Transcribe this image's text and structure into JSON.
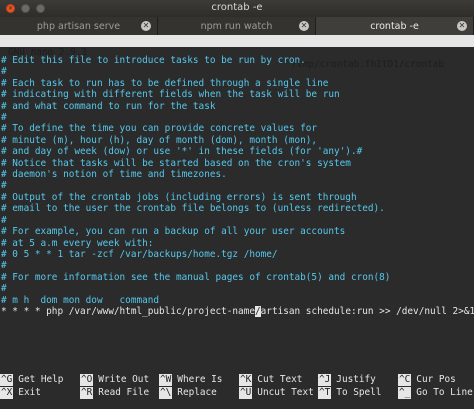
{
  "window": {
    "title": "crontab -e"
  },
  "tabs": [
    {
      "label": "php artisan serve",
      "active": false
    },
    {
      "label": "npm run watch",
      "active": false
    },
    {
      "label": "crontab -e",
      "active": true
    }
  ],
  "nano": {
    "version": "GNU nano 2.9.3",
    "filename": "/tmp/crontab.fhItD1/crontab"
  },
  "lines": [
    "# Edit this file to introduce tasks to be run by cron.",
    "#",
    "# Each task to run has to be defined through a single line",
    "# indicating with different fields when the task will be run",
    "# and what command to run for the task",
    "#",
    "# To define the time you can provide concrete values for",
    "# minute (m), hour (h), day of month (dom), month (mon),",
    "# and day of week (dow) or use '*' in these fields (for 'any').#",
    "# Notice that tasks will be started based on the cron's system",
    "# daemon's notion of time and timezones.",
    "#",
    "# Output of the crontab jobs (including errors) is sent through",
    "# email to the user the crontab file belongs to (unless redirected).",
    "#",
    "# For example, you can run a backup of all your user accounts",
    "# at 5 a.m every week with:",
    "# 0 5 * * 1 tar -zcf /var/backups/home.tgz /home/",
    "#",
    "# For more information see the manual pages of crontab(5) and cron(8)",
    "#",
    "# m h  dom mon dow   command"
  ],
  "cron_line": {
    "before": "* * * * php /var/www/html_public/project-name",
    "cursor": "/",
    "after": "artisan schedule:run >> /dev/null 2>&1"
  },
  "shortcuts": [
    {
      "key": "^G",
      "label": "Get Help"
    },
    {
      "key": "^X",
      "label": "Exit"
    },
    {
      "key": "^O",
      "label": "Write Out"
    },
    {
      "key": "^R",
      "label": "Read File"
    },
    {
      "key": "^W",
      "label": "Where Is"
    },
    {
      "key": "^\\",
      "label": "Replace"
    },
    {
      "key": "^K",
      "label": "Cut Text"
    },
    {
      "key": "^U",
      "label": "Uncut Text"
    },
    {
      "key": "^J",
      "label": "Justify"
    },
    {
      "key": "^T",
      "label": "To Spell"
    },
    {
      "key": "^C",
      "label": "Cur Pos"
    },
    {
      "key": "^_",
      "label": "Go To Line"
    }
  ],
  "colors": {
    "background": "#2b2b2b",
    "comment": "#56c8ec",
    "text": "#e6e6e6",
    "close_button": "#e95420"
  },
  "icons": {
    "window_close": "close-icon",
    "tab_close": "close-icon"
  }
}
